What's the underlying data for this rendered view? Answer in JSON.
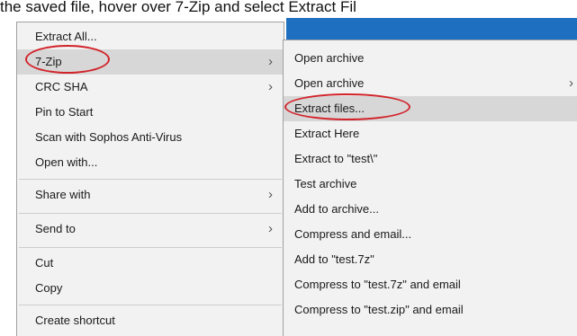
{
  "caption": "the saved file, hover over 7-Zip and select Extract Fil",
  "main_menu": {
    "items": [
      {
        "label": "Extract All..."
      },
      {
        "label": "7-Zip"
      },
      {
        "label": "CRC SHA"
      },
      {
        "label": "Pin to Start"
      },
      {
        "label": "Scan with Sophos Anti-Virus"
      },
      {
        "label": "Open with..."
      },
      {
        "label": "Share with"
      },
      {
        "label": "Send to"
      },
      {
        "label": "Cut"
      },
      {
        "label": "Copy"
      },
      {
        "label": "Create shortcut"
      }
    ]
  },
  "sub_menu": {
    "items": [
      {
        "label": "Open archive"
      },
      {
        "label": "Open archive"
      },
      {
        "label": "Extract files..."
      },
      {
        "label": "Extract Here"
      },
      {
        "label": "Extract to \"test\\\""
      },
      {
        "label": "Test archive"
      },
      {
        "label": "Add to archive..."
      },
      {
        "label": "Compress and email..."
      },
      {
        "label": "Add to \"test.7z\""
      },
      {
        "label": "Compress to \"test.7z\" and email"
      },
      {
        "label": "Compress to \"test.zip\" and email"
      }
    ]
  },
  "icons": {
    "submenu_arrow": "chevron-right-icon"
  },
  "colors": {
    "highlight": "#d7d7d7",
    "annotation_circle": "#d2232a",
    "menu_background": "#f2f2f2"
  }
}
